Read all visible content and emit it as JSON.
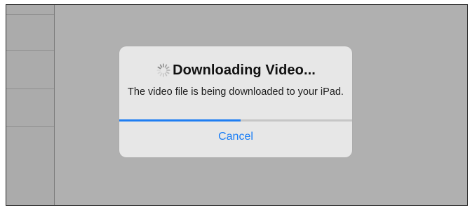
{
  "alert": {
    "title": "Downloading Video...",
    "message": "The video file is being downloaded to your iPad.",
    "cancel_label": "Cancel",
    "progress": 0.52,
    "spinner_icon": "activity-spinner"
  },
  "colors": {
    "accent": "#1a7ef6",
    "progress_fill": "#1f7ef2",
    "dialog_background": "#e7e7e7",
    "screen_background": "#b0b0b0"
  }
}
